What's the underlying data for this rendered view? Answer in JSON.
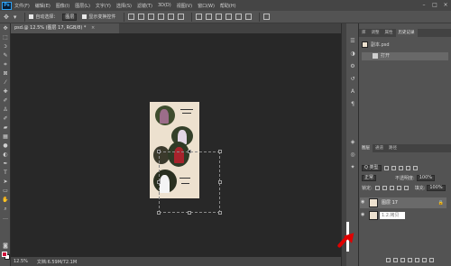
{
  "app": {
    "logo": "Ps",
    "menus": [
      "文件(F)",
      "编辑(E)",
      "图像(I)",
      "图层(L)",
      "文字(Y)",
      "选择(S)",
      "滤镜(T)",
      "3D(D)",
      "视图(V)",
      "窗口(W)",
      "帮助(H)"
    ]
  },
  "options": {
    "auto_select_label": "自动选择：",
    "auto_select_value": "图层",
    "show_transform_label": "显示变换控件"
  },
  "document": {
    "tab_title": "psd.@ 12.5% (图层 17, RGB/8) *",
    "tab_close": "×",
    "zoom": "12.5%",
    "doc_size": "文档:6.59M/72.1M"
  },
  "history_panel": {
    "tabs": [
      "库",
      "调整",
      "属性",
      "历史记录"
    ],
    "active_tab": "历史记录",
    "snapshot_label": "副本.psd",
    "items": [
      "打开"
    ]
  },
  "layers_panel": {
    "tabs": [
      "图层",
      "通道",
      "路径"
    ],
    "active_tab": "图层",
    "filter_label": "Q 类型",
    "blend_mode": "正常",
    "opacity_label": "不透明度:",
    "opacity_value": "100%",
    "lock_label": "锁定:",
    "fill_label": "填充:",
    "fill_value": "100%",
    "layers": [
      {
        "name": "图层 17",
        "selected": true
      },
      {
        "name": "1.2.拷贝",
        "selected": false
      }
    ]
  },
  "colors": {
    "foreground": "#d0103a",
    "background": "#ffffff",
    "annotation_arrow": "#e00000"
  }
}
